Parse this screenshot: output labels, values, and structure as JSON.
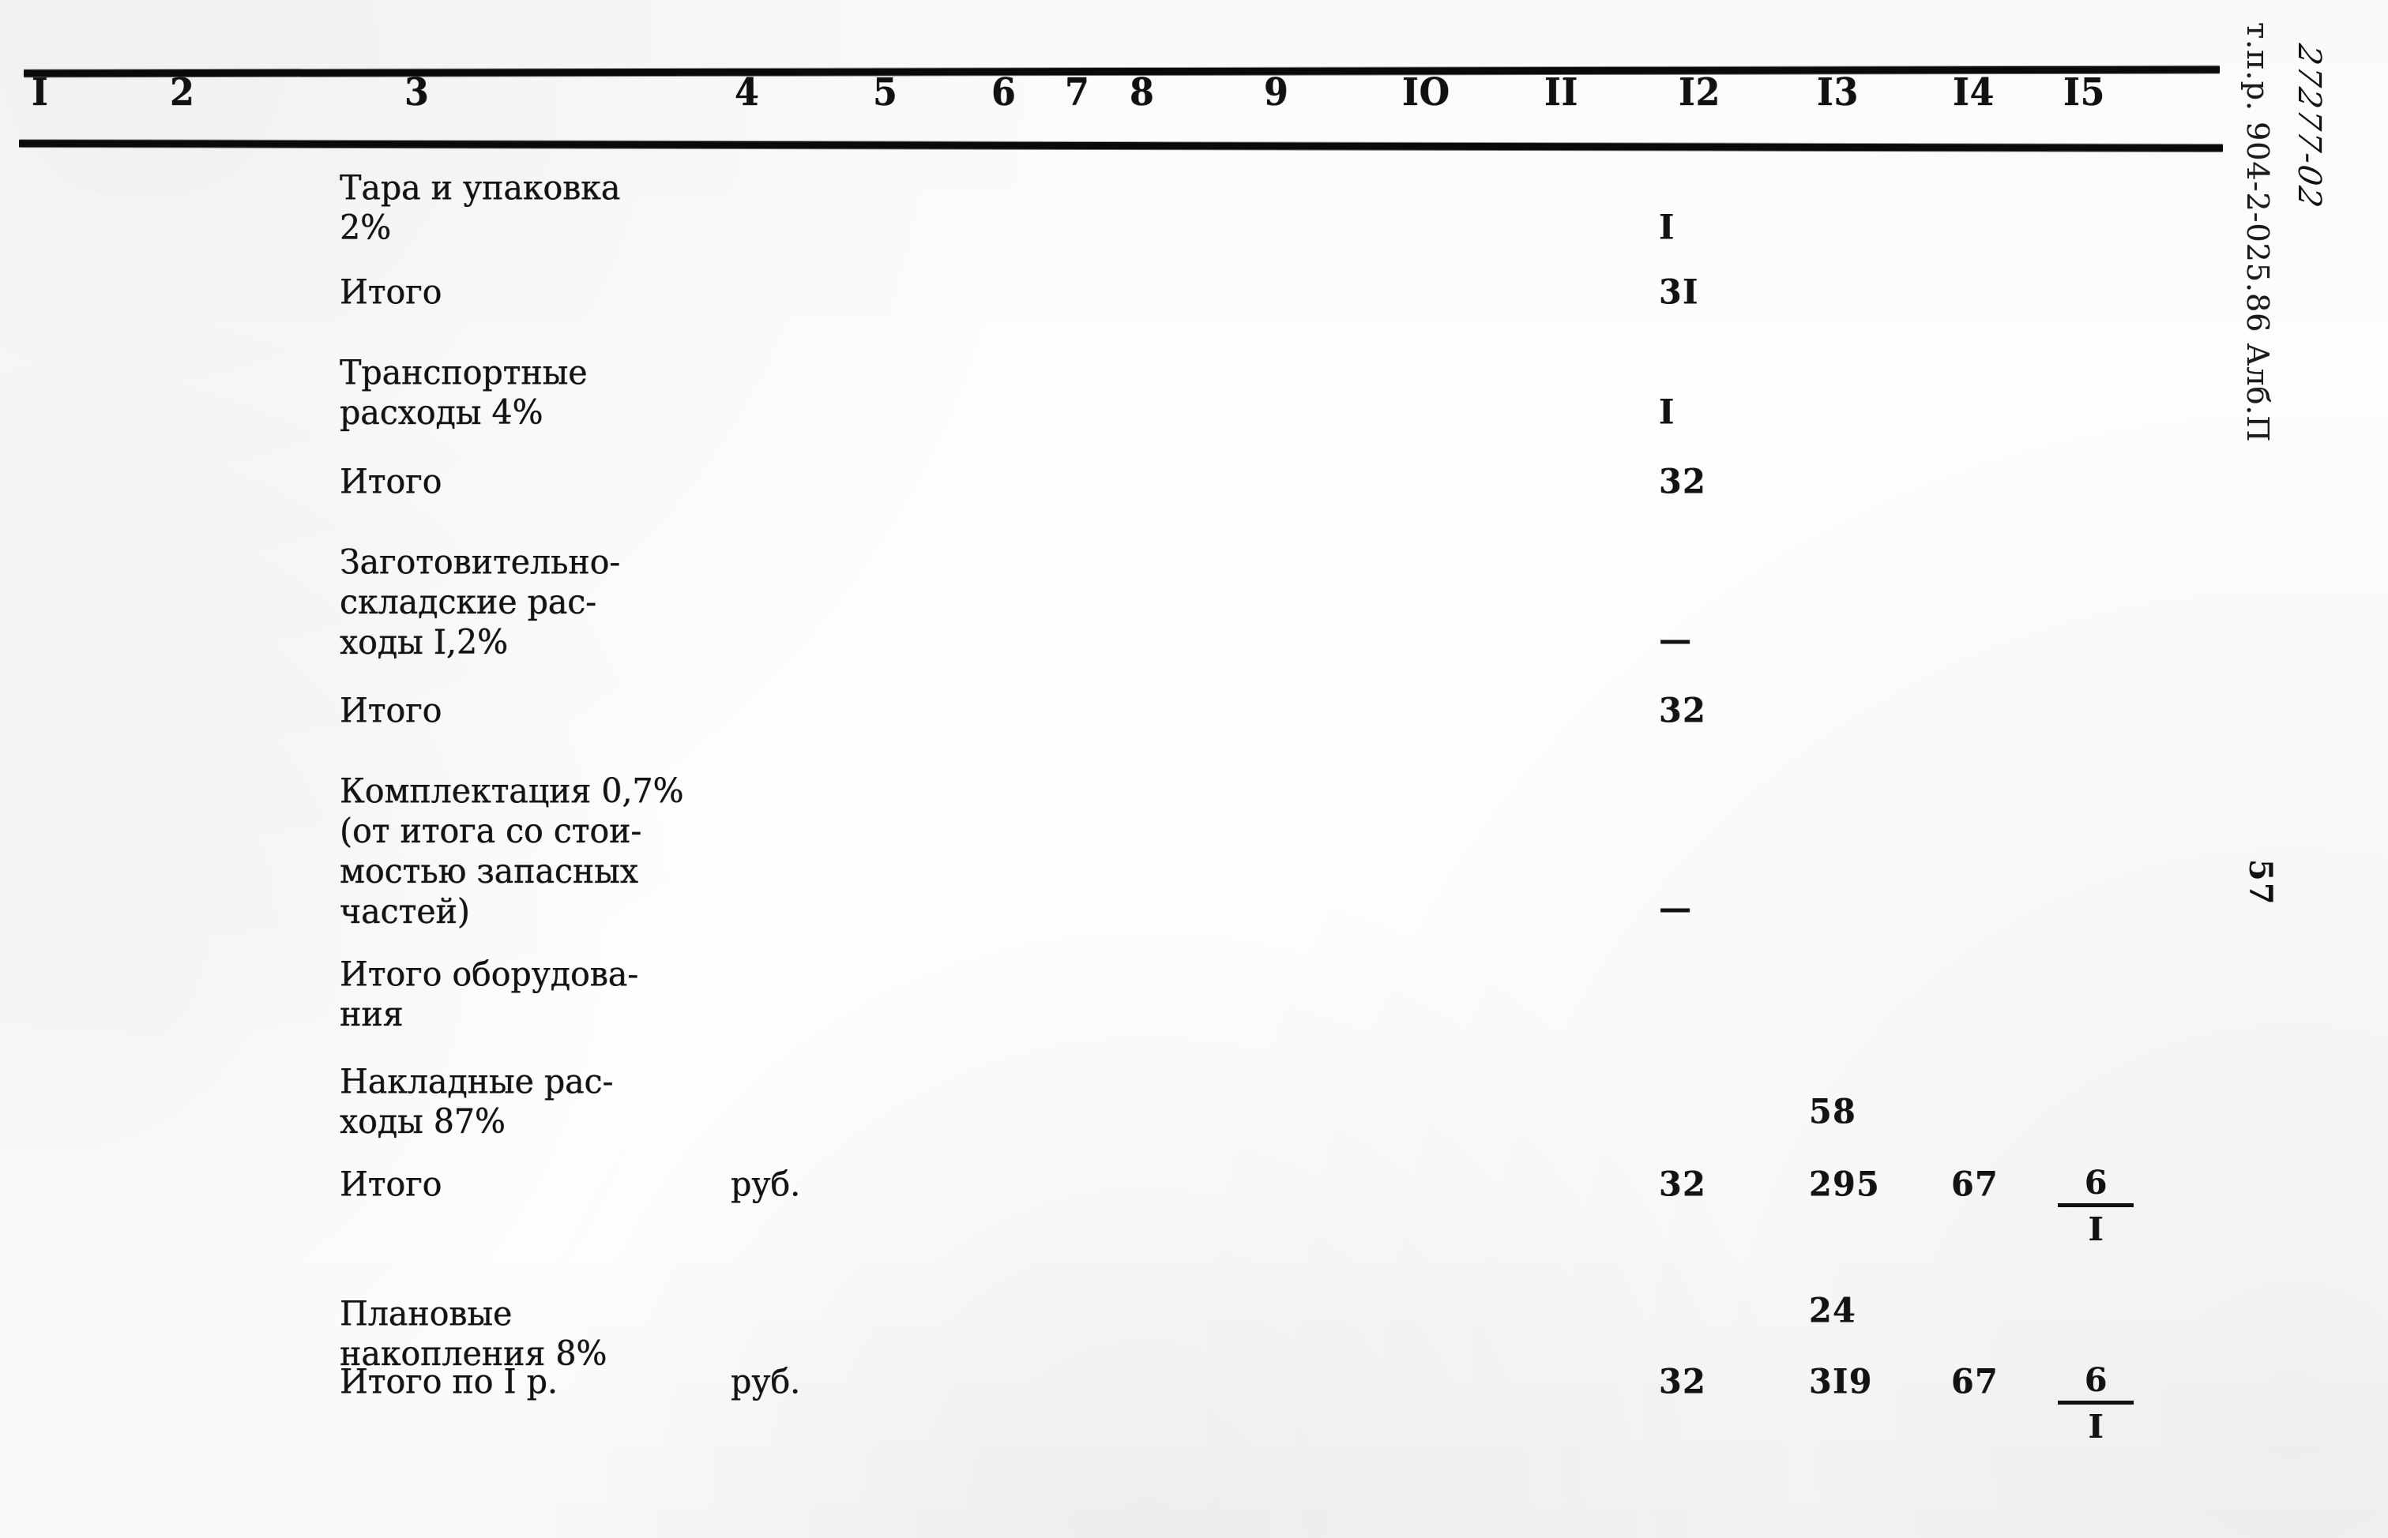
{
  "document": {
    "margin_code": "т.п.р. 904-2-025.86 Алб.П",
    "margin_handwritten": "27277-02",
    "page_number": "57"
  },
  "table": {
    "column_headers": [
      "I",
      "2",
      "3",
      "4",
      "5",
      "6",
      "7",
      "8",
      "9",
      "IO",
      "II",
      "I2",
      "I3",
      "I4",
      "I5"
    ],
    "rows": [
      {
        "description": "Тара и упаковка\n2%",
        "unit": "",
        "col12": "I",
        "col13": "",
        "col14": "",
        "col15": ""
      },
      {
        "description": "Итого",
        "unit": "",
        "col12": "3I",
        "col13": "",
        "col14": "",
        "col15": ""
      },
      {
        "description": "Транспортные\nрасходы 4%",
        "unit": "",
        "col12": "I",
        "col13": "",
        "col14": "",
        "col15": ""
      },
      {
        "description": "Итого",
        "unit": "",
        "col12": "32",
        "col13": "",
        "col14": "",
        "col15": ""
      },
      {
        "description": "Заготовительно-\nскладские рас-\nходы I,2%",
        "unit": "",
        "col12": "—",
        "col13": "",
        "col14": "",
        "col15": ""
      },
      {
        "description": "Итого",
        "unit": "",
        "col12": "32",
        "col13": "",
        "col14": "",
        "col15": ""
      },
      {
        "description": "Комплектация 0,7%\n(от итога со стои-\nмостью запасных\nчастей)",
        "unit": "",
        "col12": "—",
        "col13": "",
        "col14": "",
        "col15": ""
      },
      {
        "description": "Итого оборудова-\nния",
        "unit": "",
        "col12": "",
        "col13": "",
        "col14": "",
        "col15": ""
      },
      {
        "description": "Накладные рас-\nходы 87%",
        "unit": "",
        "col12": "",
        "col13": "58",
        "col14": "",
        "col15": ""
      },
      {
        "description": "Итого",
        "unit": "руб.",
        "col12": "32",
        "col13": "295",
        "col14": "67",
        "col15_numerator": "6",
        "col15_denominator": "I"
      },
      {
        "description": "Плановые\nнакопления 8%",
        "unit": "",
        "col12": "",
        "col13": "24",
        "col14": "",
        "col15": ""
      },
      {
        "description": "Итого по I р.",
        "unit": "руб.",
        "col12": "32",
        "col13": "3I9",
        "col14": "67",
        "col15_numerator": "6",
        "col15_denominator": "I"
      }
    ]
  }
}
